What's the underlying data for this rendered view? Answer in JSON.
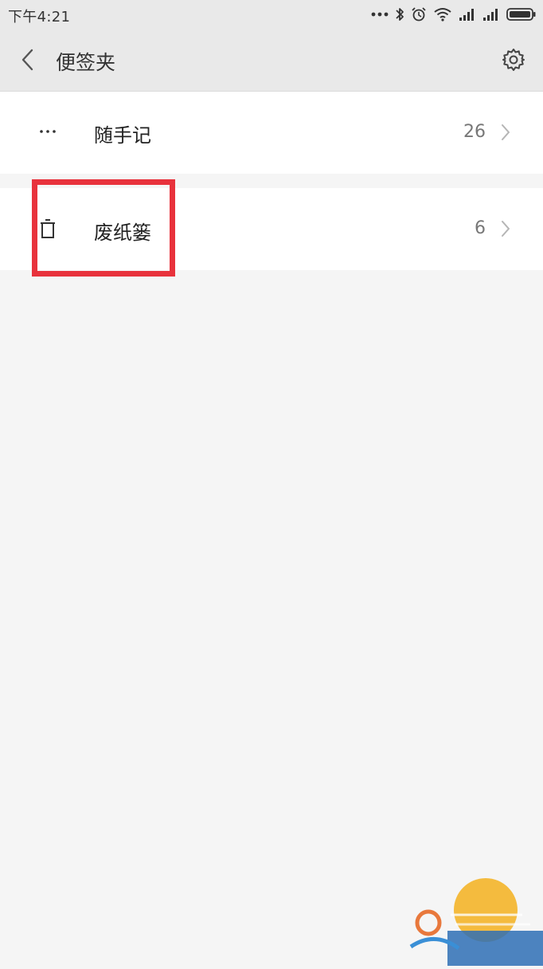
{
  "status_bar": {
    "time": "下午4:21",
    "icons": [
      "more-dots-icon",
      "bluetooth-icon",
      "alarm-icon",
      "wifi-icon",
      "signal-icon",
      "signal-icon-2",
      "battery-icon"
    ]
  },
  "header": {
    "title": "便签夹",
    "back_icon": "chevron-left-icon",
    "settings_icon": "gear-icon"
  },
  "folders": [
    {
      "icon": "more-dots-icon",
      "label": "随手记",
      "count": "26"
    },
    {
      "icon": "trash-icon",
      "label": "废纸篓",
      "count": "6"
    }
  ],
  "colors": {
    "highlight": "#e8323c",
    "header_bg": "#e9e9e9",
    "page_bg": "#f5f5f5"
  }
}
